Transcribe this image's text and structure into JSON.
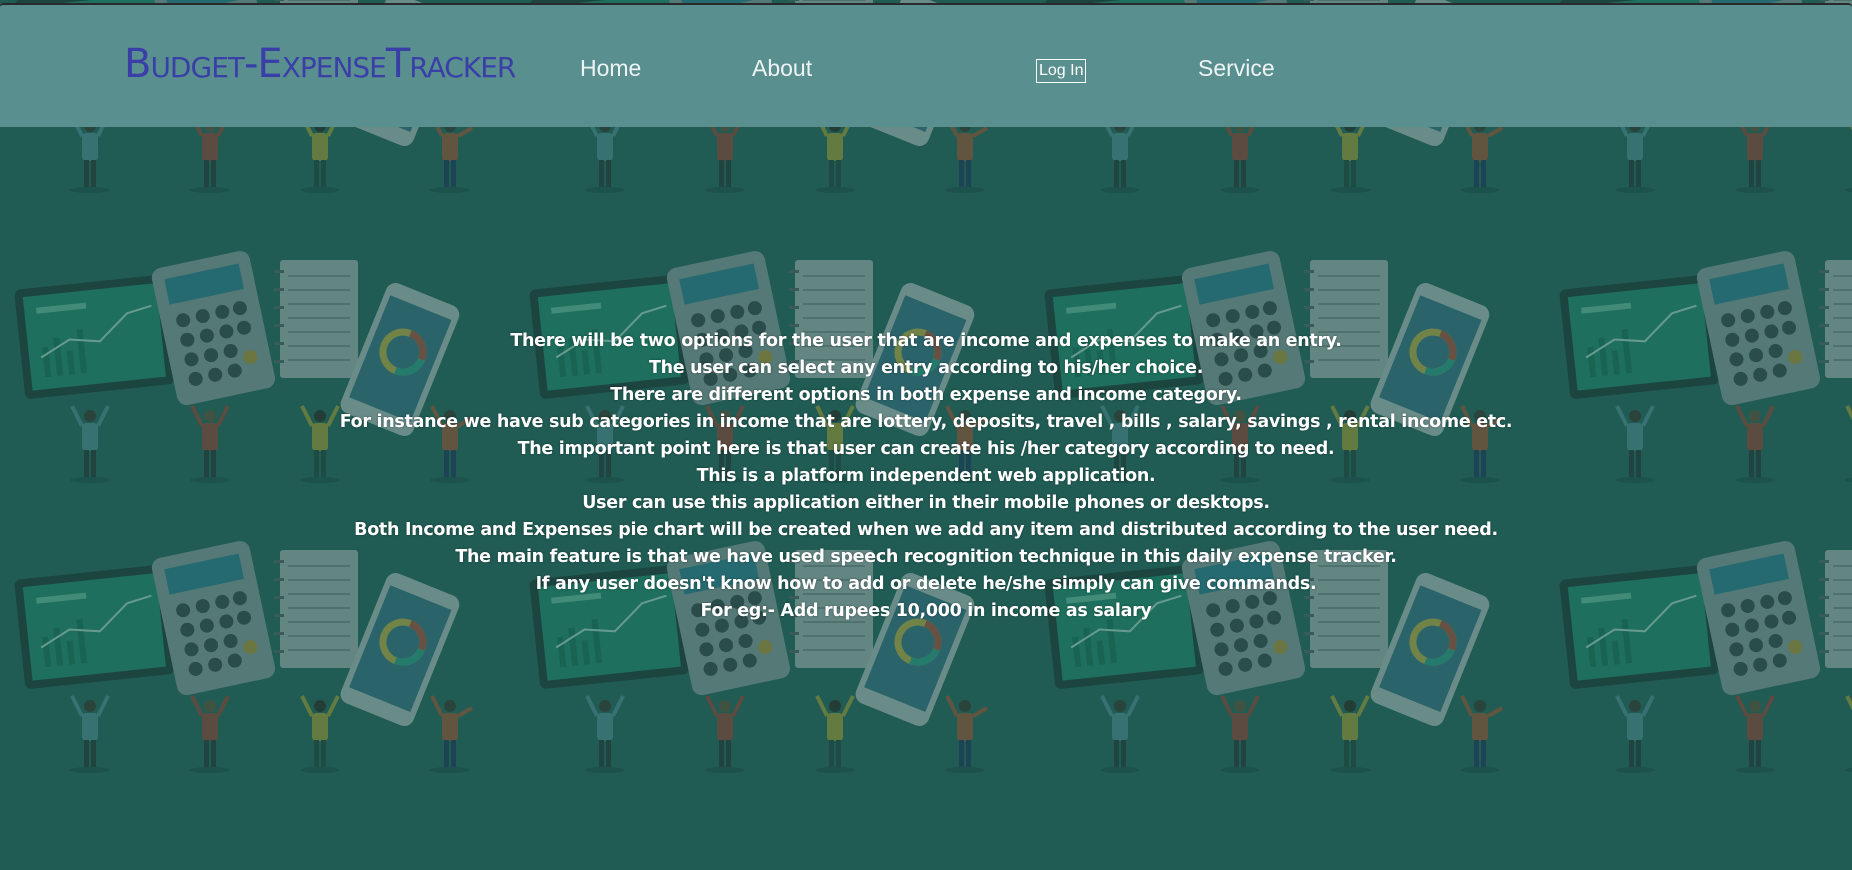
{
  "header": {
    "brand": "Budget-ExpenseTracker",
    "nav": {
      "home": "Home",
      "about": "About",
      "login": "Log In",
      "service": "Service"
    }
  },
  "main": {
    "lines": [
      "There will be two options for the user that are income and expenses to make an entry.",
      "The user can select any entry according to his/her choice.",
      "There are different options in both expense and income category.",
      "For instance we have sub categories in income that are lottery, deposits, travel , bills , salary, savings , rental income etc.",
      "The important point here is that user can create his /her category according to need.",
      "This is a platform independent web application.",
      "User can use this application either in their mobile phones or desktops.",
      "Both Income and Expenses pie chart will be created when we add any item and distributed according to the user need.",
      "The main feature is that we have used speech recognition technique in this daily expense tracker.",
      "If any user doesn't know how to add or delete he/she simply can give commands.",
      "For eg:- Add rupees 10,000 in income as salary"
    ]
  },
  "colors": {
    "navbar": "#5a8f8f",
    "brand": "#3a3fa8",
    "background": "#245f58"
  }
}
